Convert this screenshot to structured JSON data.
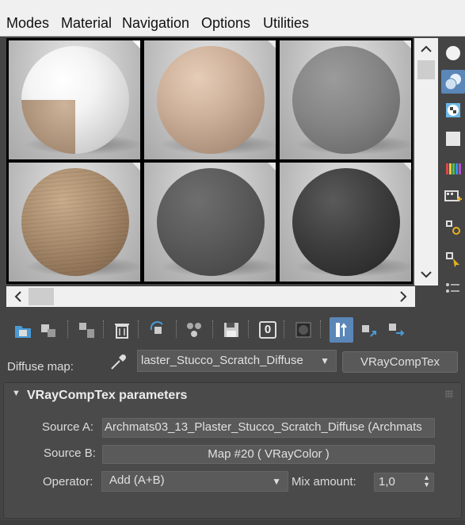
{
  "menu": {
    "items": [
      "Modes",
      "Material",
      "Navigation",
      "Options",
      "Utilities"
    ]
  },
  "slots": [
    {
      "kind": "white-checker",
      "active": true
    },
    {
      "kind": "beige-plaster",
      "active": false
    },
    {
      "kind": "grey-concrete",
      "active": false
    },
    {
      "kind": "wood-brown",
      "active": false
    },
    {
      "kind": "dark-grey",
      "active": false
    },
    {
      "kind": "black-rough",
      "active": false
    }
  ],
  "scroll": {
    "up": "▲",
    "down": "▼",
    "left": "◀",
    "right": "▶"
  },
  "right_tools": [
    "sample-type-sphere-icon",
    "backlight-icon",
    "background-checker-icon",
    "sample-uv-tiling-icon",
    "video-color-check-icon",
    "make-preview-icon",
    "options-icon",
    "select-by-material-icon",
    "material-map-navigator-icon"
  ],
  "toolbar": {
    "material_id": "0"
  },
  "map_row": {
    "label": "Diffuse map:",
    "map_name": "laster_Stucco_Scratch_Diffuse",
    "map_type": "VRayCompTex"
  },
  "rollout": {
    "title": "VRayCompTex parameters",
    "source_a_label": "Source A:",
    "source_a_value": "Archmats03_13_Plaster_Stucco_Scratch_Diffuse (Archmats",
    "source_b_label": "Source B:",
    "source_b_value": "Map #20  ( VRayColor )",
    "operator_label": "Operator:",
    "operator_value": "Add (A+B)",
    "mix_label": "Mix amount:",
    "mix_value": "1,0"
  },
  "colors": {
    "panel": "#444444",
    "accent": "#5b87b8",
    "menubar": "#f0f0f0"
  }
}
